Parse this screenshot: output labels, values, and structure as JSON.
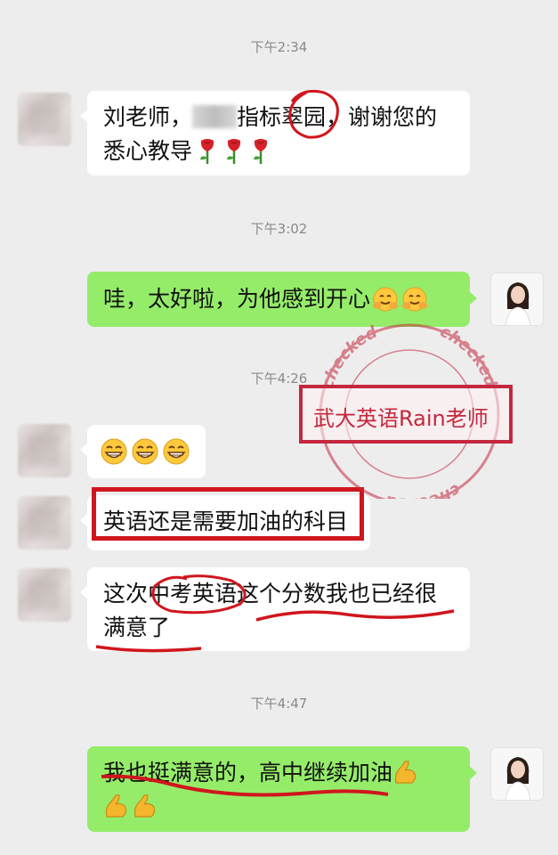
{
  "timestamps": [
    "下午2:34",
    "下午3:02",
    "下午4:26",
    "下午4:47"
  ],
  "messages": [
    {
      "side": "in",
      "text_a": "刘老师，",
      "text_b": "指标翠园，谢谢您的",
      "text_c": "悉心教导"
    },
    {
      "side": "out",
      "text": "哇，太好啦，为他感到开心"
    },
    {
      "side": "in",
      "emoji": "grin-face"
    },
    {
      "side": "in",
      "text": "英语还是需要加油的科目"
    },
    {
      "side": "in",
      "text_a": "这次中考英语这个分数我也已经很",
      "text_b": "满意了"
    },
    {
      "side": "out",
      "text": "我也挺满意的，高中继续加油"
    }
  ],
  "watermark": {
    "label": "武大英语Rain老师",
    "ring_text": "checked",
    "color": "#c4283e"
  },
  "colors": {
    "background": "#ededed",
    "outgoing_bubble": "#95ec69",
    "incoming_bubble": "#ffffff",
    "annotation_red": "#d0161d"
  }
}
